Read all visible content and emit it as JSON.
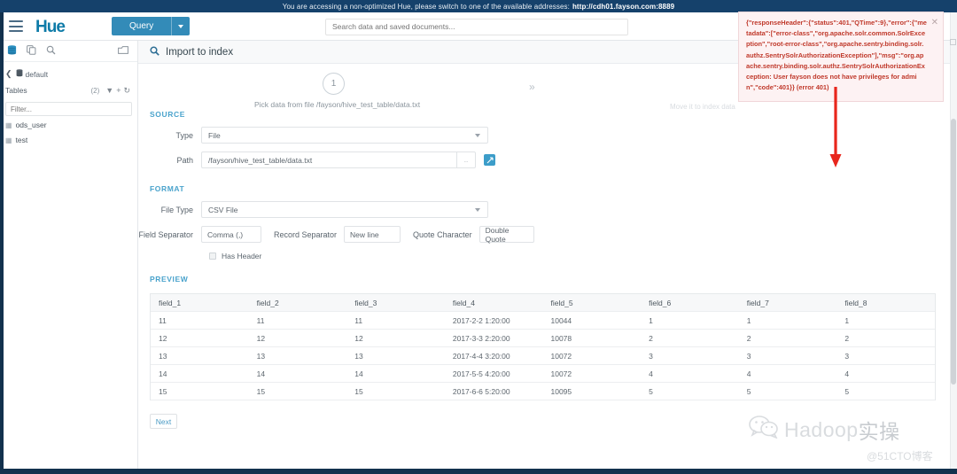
{
  "banner": {
    "text": "You are accessing a non-optimized Hue, please switch to one of the available addresses:",
    "url": "http://cdh01.fayson.com:8889"
  },
  "navbar": {
    "logo": "Hue",
    "menu_icon": "hamburger-icon",
    "query_button": "Query",
    "search_placeholder": "Search data and saved documents..."
  },
  "sidebar": {
    "icons": [
      "database-icon",
      "documents-icon",
      "search-icon",
      "folder-icon"
    ],
    "breadcrumb": "default",
    "tables_label": "Tables",
    "tables_count": "(2)",
    "actions": [
      "filter-icon",
      "plus-icon",
      "refresh-icon"
    ],
    "filter_placeholder": "Filter...",
    "tables": [
      {
        "name": "ods_user"
      },
      {
        "name": "test"
      }
    ]
  },
  "content": {
    "header_title": "Import to index",
    "step_number": "1",
    "step_caption": "Pick data from file /fayson/hive_test_table/data.txt",
    "step_next_hint": "Move it to index data",
    "sections": {
      "source_label": "SOURCE",
      "format_label": "FORMAT",
      "preview_label": "PREVIEW"
    },
    "source": {
      "type_label": "Type",
      "type_value": "File",
      "path_label": "Path",
      "path_value": "/fayson/hive_test_table/data.txt",
      "browse_label": "..",
      "hdfs_button": "hdfs-browse-icon"
    },
    "format": {
      "file_type_label": "File Type",
      "file_type_value": "CSV File",
      "field_separator_label": "Field Separator",
      "field_separator_value": "Comma (,)",
      "record_separator_label": "Record Separator",
      "record_separator_value": "New line",
      "quote_character_label": "Quote Character",
      "quote_character_value": "Double Quote",
      "has_header_label": "Has Header",
      "has_header_checked": false
    },
    "preview": {
      "columns": [
        "field_1",
        "field_2",
        "field_3",
        "field_4",
        "field_5",
        "field_6",
        "field_7",
        "field_8"
      ],
      "rows": [
        [
          "11",
          "11",
          "11",
          "2017-2-2 1:20:00",
          "10044",
          "1",
          "1",
          "1"
        ],
        [
          "12",
          "12",
          "12",
          "2017-3-3 2:20:00",
          "10078",
          "2",
          "2",
          "2"
        ],
        [
          "13",
          "13",
          "13",
          "2017-4-4 3:20:00",
          "10072",
          "3",
          "3",
          "3"
        ],
        [
          "14",
          "14",
          "14",
          "2017-5-5 4:20:00",
          "10072",
          "4",
          "4",
          "4"
        ],
        [
          "15",
          "15",
          "15",
          "2017-6-6 5:20:00",
          "10095",
          "5",
          "5",
          "5"
        ]
      ]
    },
    "next_button": "Next"
  },
  "error_popup": {
    "message": "{\"responseHeader\":{\"status\":401,\"QTime\":9},\"error\":{\"metadata\":[\"error-class\",\"org.apache.solr.common.SolrException\",\"root-error-class\",\"org.apache.sentry.binding.solr.authz.SentrySolrAuthorizationException\"],\"msg\":\"org.apache.sentry.binding.solr.authz.SentrySolrAuthorizationException: User fayson does not have privileges for admin\",\"code\":401}} (error 401)",
    "close_label": "✕"
  },
  "annotations": {
    "arrow": "red-down-arrow"
  },
  "watermarks": {
    "primary_latin": "Hadoop",
    "primary_cjk": "实操",
    "secondary": "@51CTO博客"
  },
  "colors": {
    "banner_bg": "#15416b",
    "accent_blue": "#338bb8",
    "section_label": "#4aa3cc",
    "error_red": "#c0392b",
    "arrow_red": "#e8261c"
  }
}
